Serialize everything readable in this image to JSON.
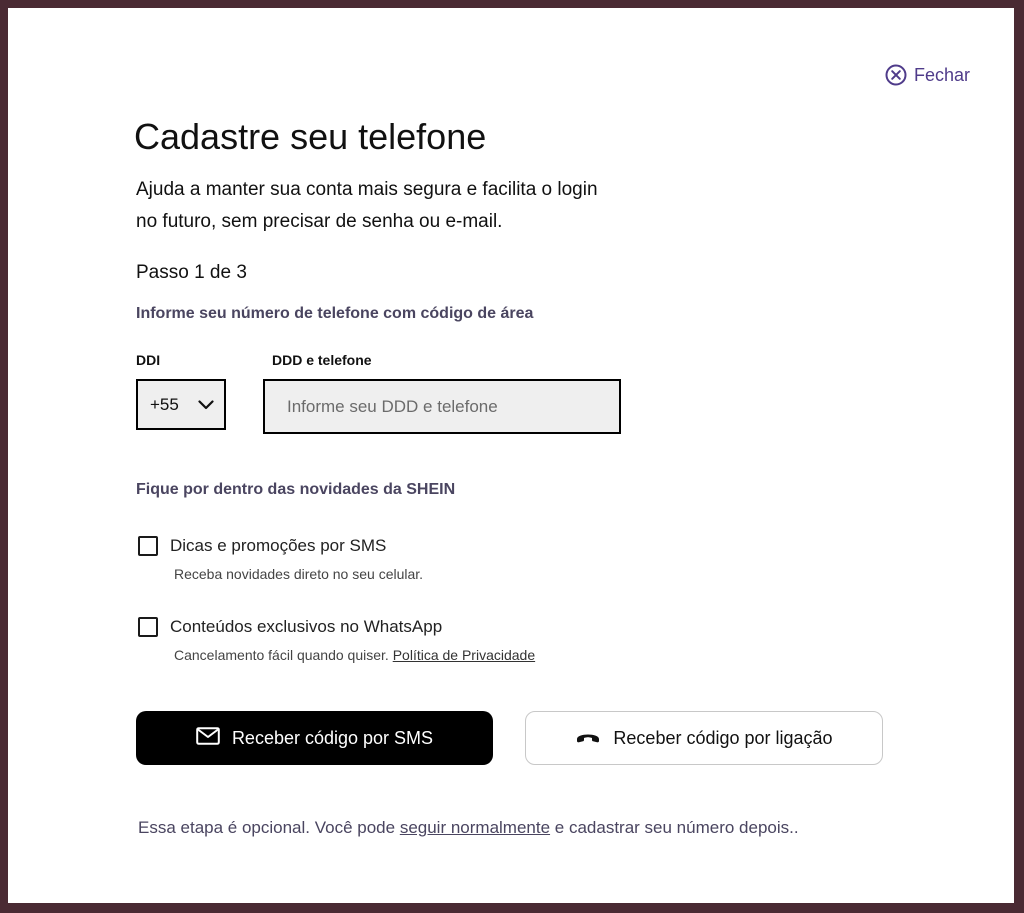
{
  "close": {
    "label": "Fechar",
    "icon": "close-circle-icon"
  },
  "header": {
    "title": "Cadastre seu telefone",
    "subtitle": "Ajuda a manter sua conta mais segura e facilita  o login\n no futuro, sem precisar de senha ou e-mail."
  },
  "step": "Passo 1 de 3",
  "instruction": "Informe seu número de telefone com código de área",
  "ddi": {
    "label": "DDI",
    "value": "+55",
    "icon": "chevron-down-icon"
  },
  "phone": {
    "label": "DDD e telefone",
    "placeholder": "Informe seu DDD e telefone",
    "value": ""
  },
  "newsletter": {
    "heading": "Fique por dentro das novidades da SHEIN",
    "options": [
      {
        "label": "Dicas e promoções por SMS",
        "description": "Receba novidades direto no seu celular.",
        "checked": false
      },
      {
        "label": "Conteúdos exclusivos no WhatsApp",
        "description": "Cancelamento fácil quando quiser.",
        "link": "Política de Privacidade",
        "checked": false
      }
    ]
  },
  "buttons": {
    "sms": {
      "label": "Receber código por SMS",
      "icon": "envelope-icon"
    },
    "call": {
      "label": "Receber código por ligação",
      "icon": "phone-icon"
    }
  },
  "footer": {
    "before": "Essa etapa é opcional. Você pode ",
    "link": "seguir normalmente",
    "after": " e cadastrar seu número depois.."
  },
  "colors": {
    "accent": "#4f3b8a",
    "primary_button": "#000000",
    "backdrop": "#4a2a33",
    "muted_text": "#4a4560"
  }
}
